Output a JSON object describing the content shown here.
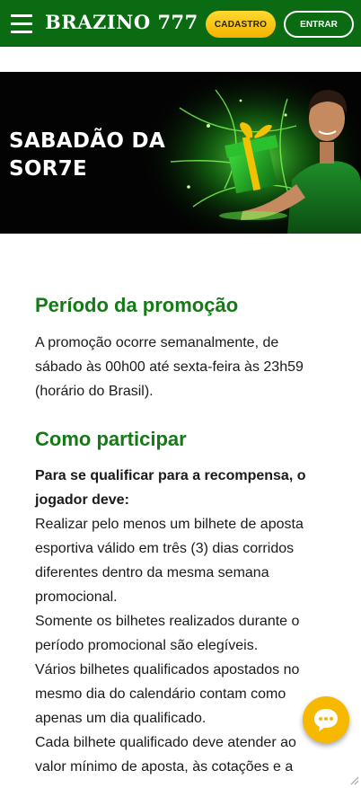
{
  "header": {
    "logo": "BRAZINO 777",
    "cadastro_label": "CADASTRO",
    "entrar_label": "ENTRAR"
  },
  "banner": {
    "title": "SABADÃO DA SOR7E"
  },
  "sections": {
    "periodo": {
      "heading": "Período da promoção",
      "text": "A promoção ocorre semanalmente, de sábado às 00h00 até sexta-feira às 23h59 (horário do Brasil)."
    },
    "como": {
      "heading": "Como participar",
      "intro": "Para se qualificar para a recompensa, o jogador deve:",
      "items": [
        "Realizar pelo menos um bilhete de aposta esportiva válido em três (3) dias corridos diferentes dentro da mesma semana promocional.",
        "Somente os bilhetes realizados durante o período promocional são elegíveis.",
        "Vários bilhetes qualificados apostados no mesmo dia do calendário contam como apenas um dia qualificado.",
        "Cada bilhete qualificado deve atender ao valor mínimo de aposta, às cotações e a"
      ]
    }
  },
  "icons": {
    "menu": "hamburger-menu-icon",
    "chat": "chat-bubble-icon",
    "gift": "gift-box-icon"
  },
  "colors": {
    "header_bg": "#0b6b12",
    "heading_green": "#137a15",
    "cta_yellow": "#f7b800",
    "banner_bg": "#030303",
    "glow_green": "#39ff3c"
  }
}
